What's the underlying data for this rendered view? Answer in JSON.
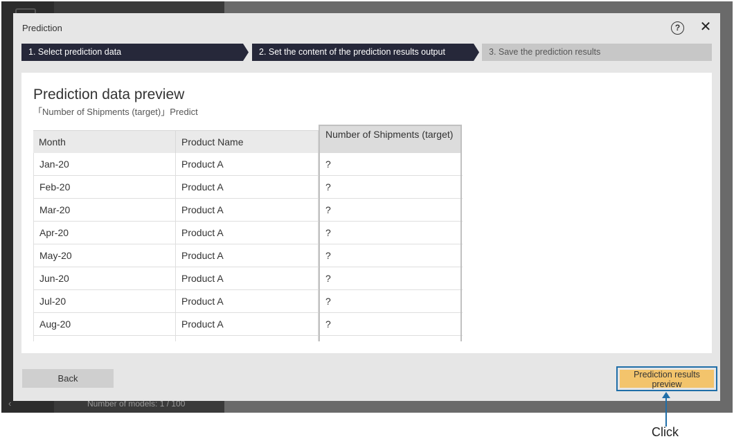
{
  "background": {
    "models_label": "Number of models: 1 / 100",
    "back_chevron": "‹"
  },
  "dialog": {
    "title": "Prediction",
    "help_symbol": "?",
    "close_symbol": "✕"
  },
  "steps": [
    {
      "label": "1. Select prediction data",
      "state": "done"
    },
    {
      "label": "2. Set the content of the prediction results output",
      "state": "current"
    },
    {
      "label": "3. Save the prediction results",
      "state": "pending"
    }
  ],
  "preview": {
    "title": "Prediction data preview",
    "subtitle": "「Number of Shipments (target)」Predict",
    "columns": [
      "Month",
      "Product Name",
      "Number of Shipments (target)"
    ],
    "rows": [
      [
        "Jan-20",
        "Product A",
        "?"
      ],
      [
        "Feb-20",
        "Product A",
        "?"
      ],
      [
        "Mar-20",
        "Product A",
        "?"
      ],
      [
        "Apr-20",
        "Product A",
        "?"
      ],
      [
        "May-20",
        "Product A",
        "?"
      ],
      [
        "Jun-20",
        "Product A",
        "?"
      ],
      [
        "Jul-20",
        "Product A",
        "?"
      ],
      [
        "Aug-20",
        "Product A",
        "?"
      ],
      [
        "",
        "",
        ""
      ]
    ]
  },
  "footer": {
    "back_label": "Back",
    "preview_label": "Prediction results preview"
  },
  "annotation": {
    "label": "Click"
  },
  "colors": {
    "step_active": "#26283a",
    "step_inactive": "#c7c7c7",
    "primary_button": "#f3c46c",
    "highlight_outline": "#1f6ea8"
  }
}
